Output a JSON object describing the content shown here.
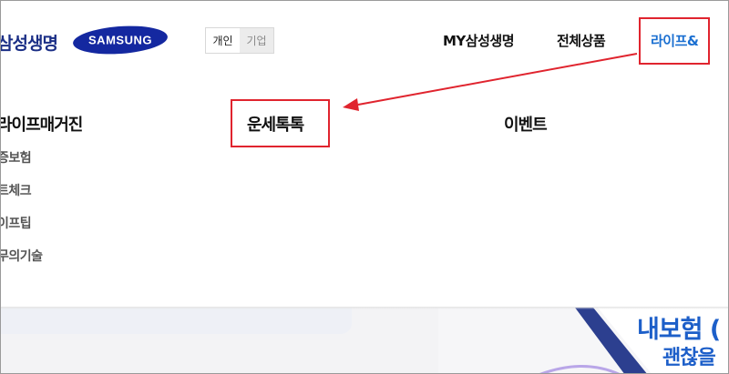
{
  "header": {
    "brand": "삼성생명",
    "logo_text": "SAMSUNG",
    "segment": [
      "개인",
      "기업"
    ],
    "nav": [
      "MY삼성생명",
      "전체상품",
      "라이프&"
    ]
  },
  "menu": {
    "columns": [
      "라이프매거진",
      "운세톡톡",
      "이벤트"
    ],
    "magazine_items": [
      "증보험",
      "트체크",
      "이프팁",
      "무의기술"
    ]
  },
  "promo": {
    "line1": "내보험 (",
    "line2": "괜찮을"
  },
  "colors": {
    "brand_blue": "#1b2f86",
    "active_blue": "#1a6fd1",
    "highlight_red": "#e0242e"
  }
}
